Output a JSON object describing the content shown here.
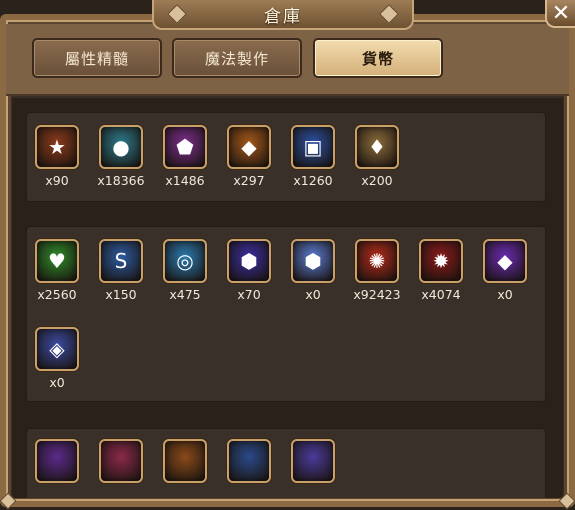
{
  "window": {
    "title": "倉庫",
    "close": "✕"
  },
  "tabs": [
    {
      "label": "屬性精髓",
      "active": false
    },
    {
      "label": "魔法製作",
      "active": false
    },
    {
      "label": "貨幣",
      "active": true
    }
  ],
  "rows": [
    {
      "items": [
        {
          "icon": "star-medal-icon",
          "glyph": "★",
          "color": "#8a3a1a",
          "count": "x90"
        },
        {
          "icon": "coin-bags-icon",
          "glyph": "●",
          "color": "#2c7a8a",
          "count": "x18366"
        },
        {
          "icon": "pentagon-shield-icon",
          "glyph": "⬟",
          "color": "#7a2c8a",
          "count": "x1486"
        },
        {
          "icon": "orange-medal-icon",
          "glyph": "◆",
          "color": "#a4581a",
          "count": "x297"
        },
        {
          "icon": "gold-chests-icon",
          "glyph": "▣",
          "color": "#2a4fa0",
          "count": "x1260"
        },
        {
          "icon": "gold-crest-icon",
          "glyph": "♦",
          "color": "#8a6a3a",
          "count": "x200"
        }
      ]
    },
    {
      "items": [
        {
          "icon": "heart-icon",
          "glyph": "♥",
          "color": "#2f8a2a",
          "count": "x2560"
        },
        {
          "icon": "swap-cards-icon",
          "glyph": "S",
          "color": "#2c5aa0",
          "count": "x150"
        },
        {
          "icon": "blue-rune-coin-icon",
          "glyph": "◎",
          "color": "#2a7ab0",
          "count": "x475"
        },
        {
          "icon": "purple-rune-crystal-icon",
          "glyph": "⬢",
          "color": "#3a2ea0",
          "count": "x70"
        },
        {
          "icon": "light-rune-crystal-icon",
          "glyph": "⬢",
          "color": "#5a7ad0",
          "count": "x0"
        },
        {
          "icon": "fire-swirl-icon",
          "glyph": "✺",
          "color": "#b02a1a",
          "count": "x92423"
        },
        {
          "icon": "fire-burst-icon",
          "glyph": "✹",
          "color": "#8a1a1a",
          "count": "x4074"
        },
        {
          "icon": "purple-diamond-icon",
          "glyph": "◆",
          "color": "#6a2ab0",
          "count": "x0"
        },
        {
          "icon": "blue-crystal-chunk-icon",
          "glyph": "◈",
          "color": "#3a4aa0",
          "count": "x0"
        }
      ]
    }
  ],
  "partial_row_icons": [
    {
      "icon": "purple-item-icon",
      "color": "#5a2a8a"
    },
    {
      "icon": "red-item-icon",
      "color": "#8a2a4a"
    },
    {
      "icon": "orange-item-icon",
      "color": "#8a4a1a"
    },
    {
      "icon": "blue-item-icon",
      "color": "#2a4a8a"
    },
    {
      "icon": "violet-item-icon",
      "color": "#4a3a9a"
    }
  ]
}
